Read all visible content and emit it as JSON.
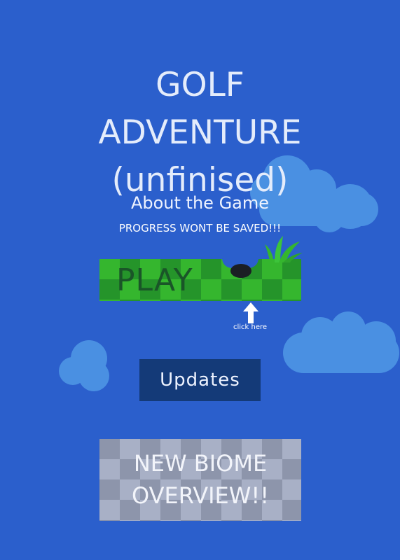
{
  "title": {
    "line1": "GOLF",
    "line2": "ADVENTURE",
    "line3": "(unfinised)"
  },
  "about": "About the Game",
  "warning": "PROGRESS WONT BE SAVED!!!",
  "play_button": {
    "label": "PLAY"
  },
  "hint": "click here",
  "updates_button": {
    "label": "Updates"
  },
  "biome_button": {
    "line1": "NEW BIOME",
    "line2": "OVERVIEW!!"
  },
  "colors": {
    "background": "#2b5fcc",
    "cloud": "#4a90e2",
    "grass_light": "#35b62e",
    "grass_dark": "#25942a",
    "updates_bg": "#143a78"
  },
  "icons": [
    "cloud-icon",
    "grass-tuft-icon",
    "up-arrow-icon"
  ]
}
